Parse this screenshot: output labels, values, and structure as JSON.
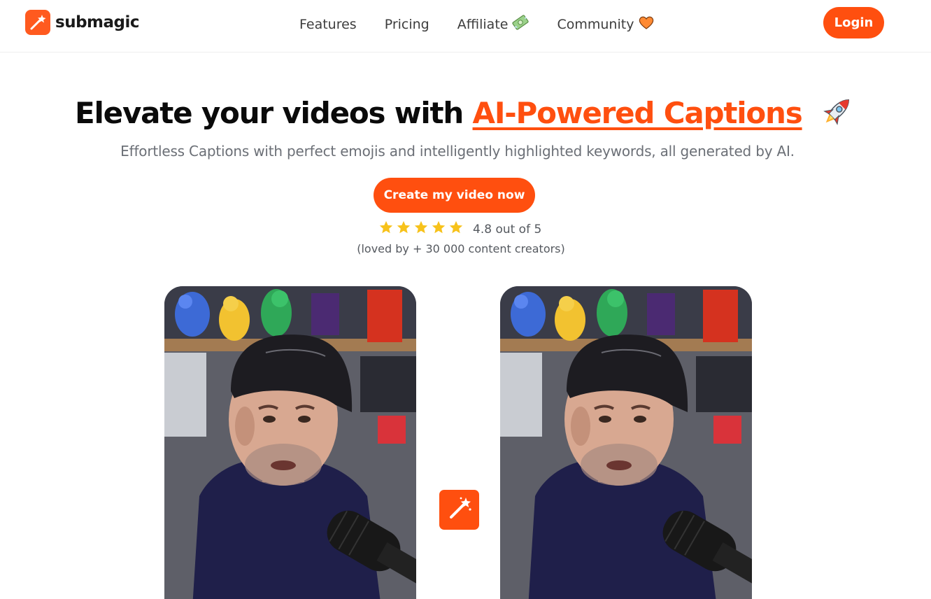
{
  "brand": {
    "name": "submagic",
    "accent_color": "#ff4f0f"
  },
  "nav": {
    "links": [
      {
        "label": "Features"
      },
      {
        "label": "Pricing"
      },
      {
        "label": "Affiliate",
        "icon": "money-icon"
      },
      {
        "label": "Community",
        "icon": "heart-icon"
      }
    ],
    "login_label": "Login"
  },
  "hero": {
    "headline_prefix": "Elevate your videos with ",
    "headline_accent": "AI-Powered Captions",
    "headline_icon": "rocket-icon",
    "subhead": "Effortless Captions with perfect emojis and intelligently highlighted keywords, all generated by AI.",
    "cta_label": "Create my video now",
    "rating": {
      "stars": 5,
      "text": "4.8 out of 5"
    },
    "loved_text": "(loved by + 30 000 content creators)"
  },
  "videos": {
    "magic_icon": "magic-wand-icon"
  }
}
